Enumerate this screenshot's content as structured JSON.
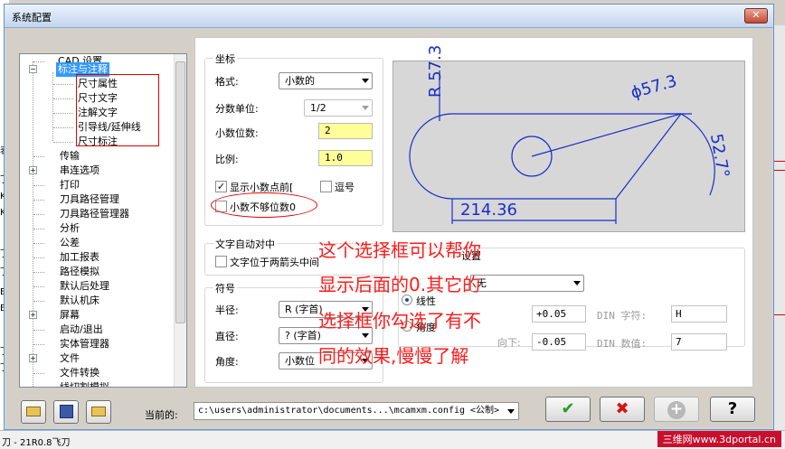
{
  "window": {
    "title": "系统配置",
    "close_glyph": "✕"
  },
  "host": {
    "left_chars": [
      "表",
      "丁",
      "K",
      "K",
      "丁",
      "丁",
      "ES",
      "ES",
      "丁",
      "丁"
    ],
    "bottom_text": "刀 - 21R0.8飞刀",
    "watermark": "三维网www.3dportal.cn"
  },
  "tree": {
    "items": [
      {
        "label": "CAD 设置"
      },
      {
        "label": "标注与注释",
        "selected": true,
        "expander": "−"
      },
      {
        "label": "尺寸属性"
      },
      {
        "label": "尺寸文字"
      },
      {
        "label": "注解文字"
      },
      {
        "label": "引导线/延伸线"
      },
      {
        "label": "尺寸标注"
      },
      {
        "label": "传输"
      },
      {
        "label": "串连选项",
        "expander": "+"
      },
      {
        "label": "打印"
      },
      {
        "label": "刀具路径管理"
      },
      {
        "label": "刀具路径管理器"
      },
      {
        "label": "分析"
      },
      {
        "label": "公差"
      },
      {
        "label": "加工报表"
      },
      {
        "label": "路径模拟"
      },
      {
        "label": "默认后处理"
      },
      {
        "label": "默认机床"
      },
      {
        "label": "屏幕",
        "expander": "+"
      },
      {
        "label": "启动/退出"
      },
      {
        "label": "实体管理器"
      },
      {
        "label": "文件",
        "expander": "+"
      },
      {
        "label": "文件转换"
      },
      {
        "label": "线切割模拟"
      }
    ]
  },
  "coords": {
    "group_label": "坐标",
    "format_label": "格式:",
    "format_value": "小数的",
    "fraction_label": "分数单位:",
    "fraction_value": "1/2",
    "decimals_label": "小数位数:",
    "decimals_value": "2",
    "scale_label": "比例:",
    "scale_value": "1.0",
    "show_leading_label": "显示小数点前[",
    "show_leading_checked": "✓",
    "comma_label": "逗号",
    "trailing_zeros_label": "小数不够位数0"
  },
  "text_center": {
    "group_label": "文字自动对中",
    "center_label": "文字位于两箭头中间"
  },
  "symbols": {
    "group_label": "符号",
    "radius_label": "半径:",
    "radius_value": "R (字首)",
    "diameter_label": "直径:",
    "diameter_value": "? (字首)",
    "angle_label": "角度:",
    "angle_value": "小数位"
  },
  "tolerance": {
    "group_label": "设置",
    "combo_value": "无",
    "linear_label": "线性",
    "angular_label": "角度",
    "upper_value": "+0.05",
    "lower_label": "向下:",
    "lower_value": "-0.05",
    "din_char_label": "DIN 字符:",
    "din_char_value": "H",
    "din_num_label": "DIN 数值:",
    "din_num_value": "7"
  },
  "preview": {
    "radius_text": "R 57.3",
    "diameter_text": "ϕ57.3",
    "angle_text": "52.7°",
    "length_text": "214.36"
  },
  "annotation": {
    "lines": [
      "这个选择框可以帮你",
      "显示后面的0.其它的",
      "选择框你勾选了有不",
      "同的效果,慢慢了解"
    ]
  },
  "footer": {
    "current_label": "当前的:",
    "path_value": "c:\\users\\administrator\\documents...\\mcamxm.config <公制>",
    "ok_glyph": "✔",
    "cancel_glyph": "✖",
    "add_glyph": "+",
    "help_glyph": "?"
  },
  "colors": {
    "ok": "#1fa01f",
    "cancel": "#d01818",
    "annotation": "#ff1a1a",
    "selection": "#3399ff",
    "drawing": "#1a2fc8"
  }
}
